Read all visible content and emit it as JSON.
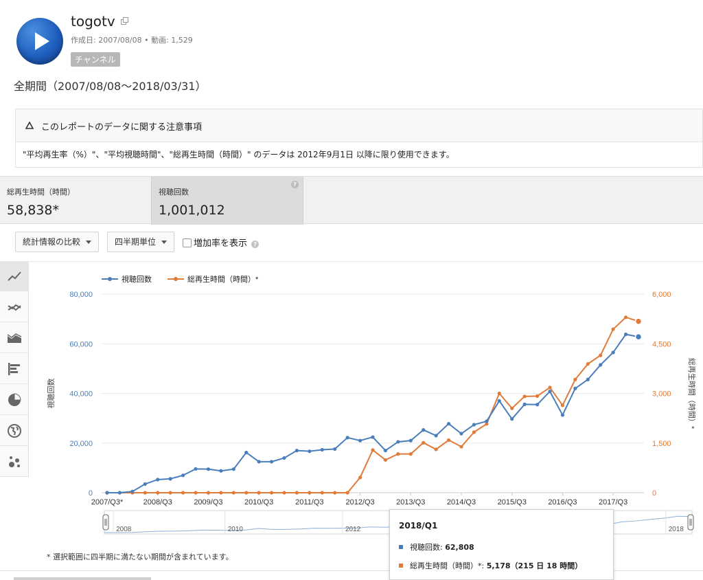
{
  "channel": {
    "title": "togotv",
    "meta": "作成日: 2007/08/08 • 動画: 1,529",
    "badge": "チャンネル"
  },
  "period": "全期間（2007/08/08〜2018/03/31）",
  "notice": {
    "title": "このレポートのデータに関する注意事項",
    "body": "\"平均再生率（%）\"、\"平均視聴時間\"、\"総再生時間（時間）\" のデータは 2012年9月1日 以降に限り使用できます。"
  },
  "metrics": [
    {
      "label": "総再生時間（時間）",
      "value": "58,838*"
    },
    {
      "label": "視聴回数",
      "value": "1,001,012"
    }
  ],
  "controls": {
    "compare_label": "統計情報の比較",
    "interval_label": "四半期単位",
    "growth_label": "増加率を表示"
  },
  "tools": [
    "line-chart-icon",
    "multi-line-icon",
    "area-chart-icon",
    "bar-chart-icon",
    "pie-chart-icon",
    "globe-icon",
    "bubble-chart-icon"
  ],
  "colors": {
    "views": "#4a7ebb",
    "watch": "#e07b39"
  },
  "chart_data": {
    "type": "line",
    "x": [
      "2007/Q3*",
      "2007/Q4",
      "2008/Q1",
      "2008/Q2",
      "2008/Q3",
      "2008/Q4",
      "2009/Q1",
      "2009/Q2",
      "2009/Q3",
      "2009/Q4",
      "2010/Q1",
      "2010/Q2",
      "2010/Q3",
      "2010/Q4",
      "2011/Q1",
      "2011/Q2",
      "2011/Q3",
      "2011/Q4",
      "2012/Q1",
      "2012/Q2",
      "2012/Q3",
      "2012/Q4",
      "2013/Q1",
      "2013/Q2",
      "2013/Q3",
      "2013/Q4",
      "2014/Q1",
      "2014/Q2",
      "2014/Q3",
      "2014/Q4",
      "2015/Q1",
      "2015/Q2",
      "2015/Q3",
      "2015/Q4",
      "2016/Q1",
      "2016/Q2",
      "2016/Q3",
      "2016/Q4",
      "2017/Q1",
      "2017/Q2",
      "2017/Q3",
      "2017/Q4",
      "2018/Q1"
    ],
    "xticks": [
      "2007/Q3*",
      "2008/Q3",
      "2009/Q3",
      "2010/Q3",
      "2011/Q3",
      "2012/Q3",
      "2013/Q3",
      "2014/Q3",
      "2015/Q3",
      "2016/Q3",
      "2017/Q3"
    ],
    "series": [
      {
        "name": "視聴回数",
        "axis": "left",
        "values": [
          0,
          0,
          500,
          3500,
          5300,
          5600,
          7000,
          9600,
          9500,
          8800,
          9500,
          16200,
          12500,
          12500,
          14000,
          17000,
          16700,
          17300,
          17600,
          22200,
          21000,
          22400,
          17000,
          20500,
          21000,
          25300,
          23000,
          27800,
          23800,
          27400,
          28800,
          37000,
          29700,
          35600,
          35500,
          40800,
          31300,
          42000,
          45600,
          51500,
          56500,
          63800,
          62808
        ]
      },
      {
        "name": "総再生時間（時間）*",
        "axis": "right",
        "values": [
          0,
          0,
          0,
          0,
          0,
          0,
          0,
          0,
          0,
          0,
          0,
          0,
          0,
          0,
          0,
          0,
          0,
          0,
          0,
          0,
          460,
          1290,
          990,
          1170,
          1170,
          1510,
          1310,
          1590,
          1390,
          1830,
          2080,
          3000,
          2550,
          2910,
          2920,
          3180,
          2640,
          3420,
          3890,
          4150,
          4940,
          5300,
          5178
        ]
      }
    ],
    "ylabel_left": "視聴回数",
    "ylabel_right": "総再生時間（時間）*",
    "ylim_left": [
      0,
      80000
    ],
    "ylim_right": [
      0,
      6000
    ],
    "yticks_left": [
      "0",
      "20,000",
      "40,000",
      "60,000",
      "80,000"
    ],
    "yticks_right": [
      "0",
      "1,500",
      "3,000",
      "4,500",
      "6,000"
    ],
    "legend_position": "top-left",
    "grid": true,
    "navigator_years": [
      "2008",
      "2010",
      "2012",
      "2018"
    ]
  },
  "tooltip": {
    "title": "2018/Q1",
    "views_label": "視聴回数:",
    "views_value": "62,808",
    "watch_label": "総再生時間（時間）*:",
    "watch_value": "5,178（215 日 18 時間）"
  },
  "footnote": "* 選択範囲に四半期に満たない期間が含まれています。"
}
